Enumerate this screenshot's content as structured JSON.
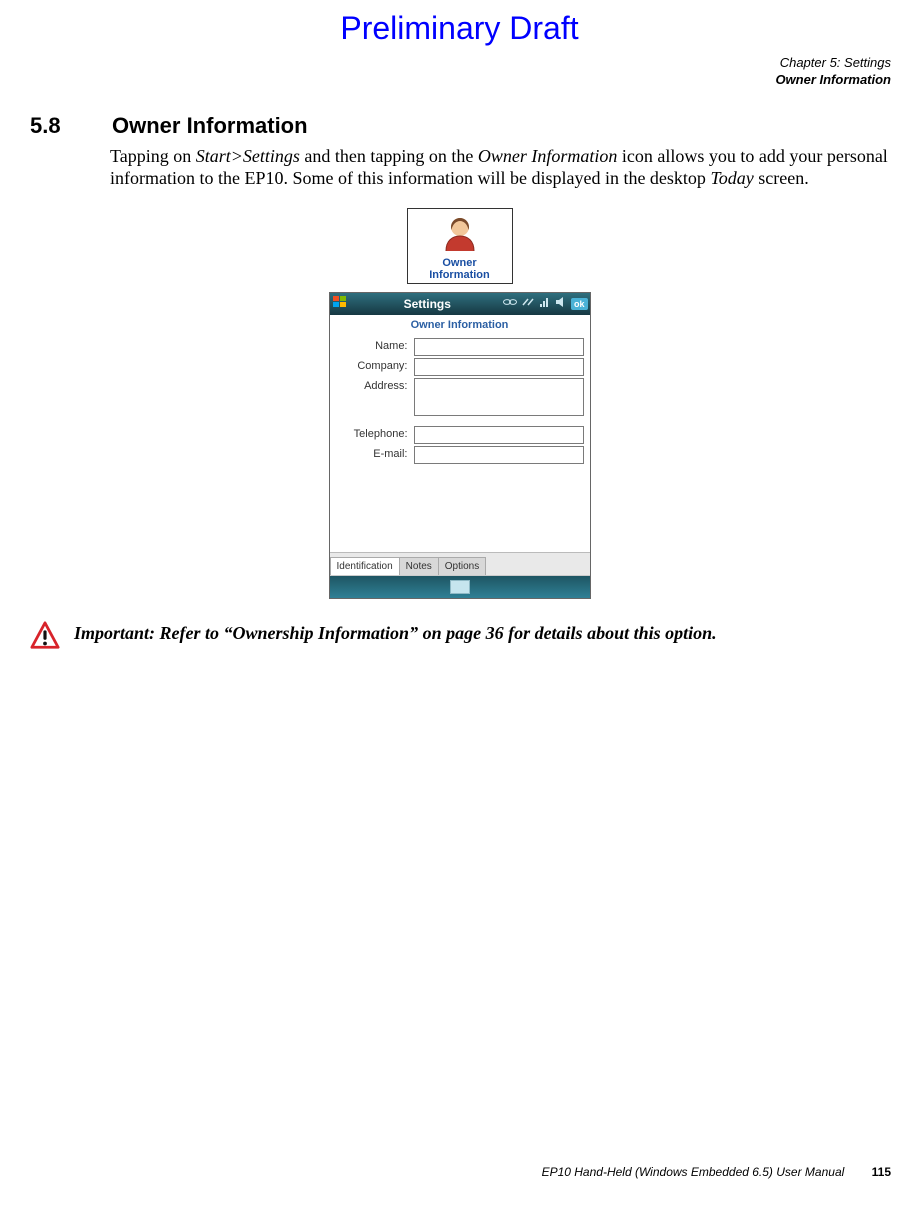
{
  "preliminary": "Preliminary Draft",
  "chapter": {
    "line1": "Chapter 5:  Settings",
    "line2": "Owner Information"
  },
  "section": {
    "number": "5.8",
    "title": "Owner Information"
  },
  "paragraph": {
    "t1": "Tapping on ",
    "i1": "Start>Settings",
    "t2": " and then tapping on the ",
    "i2": "Owner Information",
    "t3": " icon allows you to add your personal information to the EP10. Some of this information will be displayed in the desktop ",
    "i3": "Today",
    "t4": " screen."
  },
  "icon": {
    "label_l1": "Owner",
    "label_l2": "Information"
  },
  "device": {
    "title": "Settings",
    "ok": "ok",
    "panel_title": "Owner Information",
    "labels": {
      "name": "Name:",
      "company": "Company:",
      "address": "Address:",
      "telephone": "Telephone:",
      "email": "E-mail:"
    },
    "tabs": {
      "identification": "Identification",
      "notes": "Notes",
      "options": "Options"
    }
  },
  "important": {
    "prefix": "Important:  ",
    "text": "Refer to “Ownership Information” on page 36 for details about this option."
  },
  "footer": {
    "manual": "EP10 Hand-Held (Windows Embedded 6.5) User Manual",
    "page": "115"
  }
}
